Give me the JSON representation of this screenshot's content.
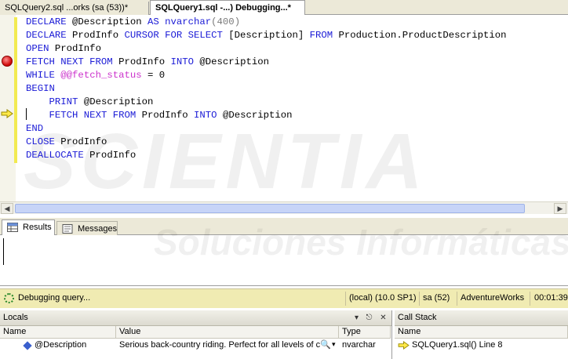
{
  "tabs": [
    {
      "label": "SQLQuery2.sql ...orks (sa (53))*",
      "active": false
    },
    {
      "label": "SQLQuery1.sql -...) Debugging...*",
      "active": true
    }
  ],
  "code_lines": [
    {
      "tokens": [
        {
          "t": "DECLARE",
          "c": "kw"
        },
        {
          "t": " @Description ",
          "c": ""
        },
        {
          "t": "AS",
          "c": "kw"
        },
        {
          "t": " ",
          "c": ""
        },
        {
          "t": "nvarchar",
          "c": "kw"
        },
        {
          "t": "(400)",
          "c": "gray"
        }
      ]
    },
    {
      "tokens": [
        {
          "t": "DECLARE",
          "c": "kw"
        },
        {
          "t": " ProdInfo ",
          "c": ""
        },
        {
          "t": "CURSOR FOR SELECT",
          "c": "kw"
        },
        {
          "t": " [Description] ",
          "c": ""
        },
        {
          "t": "FROM",
          "c": "kw"
        },
        {
          "t": " Production.ProductDescription",
          "c": ""
        }
      ]
    },
    {
      "tokens": [
        {
          "t": "OPEN",
          "c": "kw"
        },
        {
          "t": " ProdInfo",
          "c": ""
        }
      ]
    },
    {
      "tokens": [
        {
          "t": "FETCH NEXT FROM",
          "c": "kw"
        },
        {
          "t": " ProdInfo ",
          "c": ""
        },
        {
          "t": "INTO",
          "c": "kw"
        },
        {
          "t": " @Description",
          "c": ""
        }
      ]
    },
    {
      "tokens": [
        {
          "t": "WHILE",
          "c": "kw"
        },
        {
          "t": " ",
          "c": ""
        },
        {
          "t": "@@fetch_status",
          "c": "mag"
        },
        {
          "t": " = 0",
          "c": ""
        }
      ]
    },
    {
      "tokens": [
        {
          "t": "BEGIN",
          "c": "kw"
        }
      ]
    },
    {
      "tokens": [
        {
          "t": "    ",
          "c": ""
        },
        {
          "t": "PRINT",
          "c": "kw"
        },
        {
          "t": " @Description",
          "c": ""
        }
      ]
    },
    {
      "tokens": [
        {
          "t": "    ",
          "c": ""
        },
        {
          "t": "FETCH NEXT FROM",
          "c": "kw"
        },
        {
          "t": " ProdInfo ",
          "c": ""
        },
        {
          "t": "INTO",
          "c": "kw"
        },
        {
          "t": " @Description",
          "c": ""
        }
      ]
    },
    {
      "tokens": [
        {
          "t": "END",
          "c": "kw"
        }
      ]
    },
    {
      "tokens": [
        {
          "t": "CLOSE",
          "c": "kw"
        },
        {
          "t": " ProdInfo",
          "c": ""
        }
      ]
    },
    {
      "tokens": [
        {
          "t": "DEALLOCATE",
          "c": "kw"
        },
        {
          "t": " ProdInfo",
          "c": ""
        }
      ]
    }
  ],
  "watermark": {
    "big": "SCIENTIA",
    "sub": "Soluciones Informáticas"
  },
  "results_tabs": {
    "results": "Results",
    "messages": "Messages"
  },
  "status": {
    "text": "Debugging query...",
    "server": "(local) (10.0 SP1)",
    "user": "sa (52)",
    "database": "AdventureWorks",
    "time": "00:01:39"
  },
  "locals": {
    "title": "Locals",
    "pin": "↓",
    "close": "✕",
    "cols": [
      "Name",
      "Value",
      "Type"
    ],
    "row": {
      "name": "@Description",
      "value": "Serious back-country riding. Perfect for all levels of c",
      "type": "nvarchar"
    }
  },
  "callstack": {
    "title": "Call Stack",
    "col": "Name",
    "row": "SQLQuery1.sql() Line 8"
  }
}
